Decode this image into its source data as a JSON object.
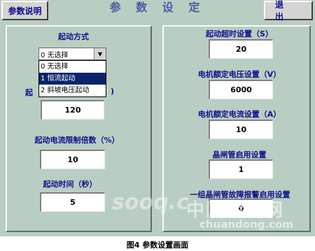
{
  "header": {
    "help_button": "参数说明",
    "title": "参 数 设 定",
    "exit_button": "退 出"
  },
  "left_panel": {
    "start_mode": {
      "label": "起动方式",
      "selected": "0 无选择",
      "options": [
        "0 无选择",
        "1 恒流起动",
        "2 斜坡电压起动"
      ],
      "highlighted_index": 1
    },
    "hidden_label_left": "起",
    "hidden_label_right": ")",
    "field1_value": "120",
    "current_limit": {
      "label": "起动电流限制倍数（%）",
      "value": "10"
    },
    "start_time": {
      "label": "起动时间（秒）",
      "value": "5"
    }
  },
  "right_panel": {
    "timeout": {
      "label": "起动超时设置（S）",
      "value": "20"
    },
    "rated_voltage": {
      "label": "电机额定电压设置（V）",
      "value": "6000"
    },
    "rated_current": {
      "label": "电机额定电流设置（A）",
      "value": "10"
    },
    "thyristor_enable": {
      "label": "晶闸管启用设置",
      "value": "1"
    },
    "fault_alarm": {
      "label": "一组晶闸管故障报警启用设置",
      "value": "0"
    }
  },
  "watermark": {
    "text1": "sooq.c",
    "text2": "中国传动网",
    "text3": "chuandong.com"
  },
  "caption": "图4  参数设置画面"
}
